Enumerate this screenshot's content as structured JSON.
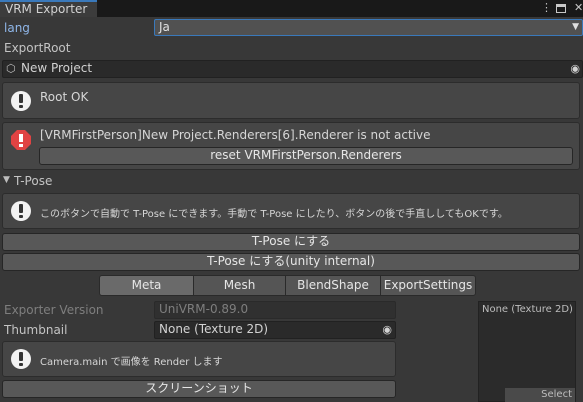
{
  "window": {
    "tab_title": "VRM Exporter"
  },
  "lang": {
    "label": "lang",
    "value": "Ja"
  },
  "export_root": {
    "label": "ExportRoot",
    "value": "New Project"
  },
  "messages": {
    "root_ok": "Root OK",
    "first_person_error": "[VRMFirstPerson]New Project.Renderers[6].Renderer is not active",
    "reset_button": "reset VRMFirstPerson.Renderers"
  },
  "tpose": {
    "foldout_label": "T-Pose",
    "help": "このボタンで自動で T-Pose にできます。手動で T-Pose にしたり、ボタンの後で手直ししてもOKです。",
    "button1": "T-Pose にする",
    "button2": "T-Pose にする(unity internal)"
  },
  "tabs": [
    "Meta",
    "Mesh",
    "BlendShape",
    "ExportSettings"
  ],
  "active_tab": "Meta",
  "meta": {
    "exporter_version_label": "Exporter Version",
    "exporter_version_value": "UniVRM-0.89.0",
    "thumbnail_label": "Thumbnail",
    "thumbnail_value": "None (Texture 2D)",
    "camera_help": "Camera.main で画像を Render します",
    "screenshot_button": "スクリーンショット"
  },
  "texture_preview": {
    "label": "None (Texture 2D)",
    "select": "Select"
  },
  "colors": {
    "accent": "#3a79bb",
    "error": "#e04343",
    "info": "#f2f2f2"
  }
}
